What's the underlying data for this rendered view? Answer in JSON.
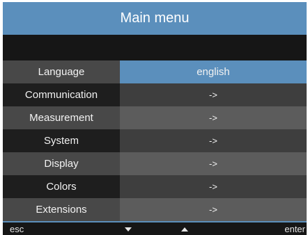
{
  "header": {
    "title": "Main menu"
  },
  "menu": {
    "items": [
      {
        "label": "Language",
        "value": "english"
      },
      {
        "label": "Communication",
        "value": "->"
      },
      {
        "label": "Measurement",
        "value": "->"
      },
      {
        "label": "System",
        "value": "->"
      },
      {
        "label": "Display",
        "value": "->"
      },
      {
        "label": "Colors",
        "value": "->"
      },
      {
        "label": "Extensions",
        "value": "->"
      }
    ]
  },
  "footer": {
    "esc_label": "esc",
    "enter_label": "enter",
    "down_icon": "triangle-down-icon",
    "up_icon": "triangle-up-icon"
  },
  "colors": {
    "accent": "#5b8fbc",
    "background_dark": "#161616"
  }
}
